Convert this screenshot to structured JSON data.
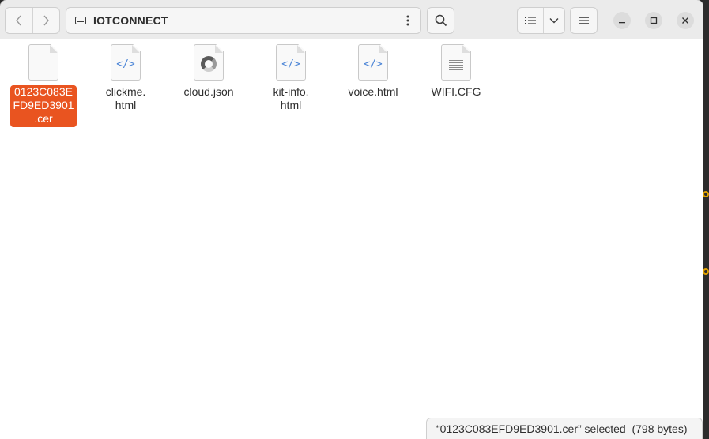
{
  "window": {
    "path_label": "IOTCONNECT",
    "icons": {
      "back": "chevron-left-icon",
      "forward": "chevron-right-icon",
      "drive": "drive-icon",
      "path_menu": "kebab-icon",
      "search": "search-icon",
      "view": "list-view-icon",
      "view_options": "chevron-down-icon",
      "menu": "hamburger-icon",
      "minimize": "minimize-icon",
      "maximize": "maximize-icon",
      "close": "close-icon"
    }
  },
  "files": [
    {
      "name": "0123C083E\nFD9ED3901\n.cer",
      "kind": "blank",
      "selected": true
    },
    {
      "name": "clickme.\nhtml",
      "kind": "code"
    },
    {
      "name": "cloud.json",
      "kind": "json"
    },
    {
      "name": "kit-info.\nhtml",
      "kind": "code"
    },
    {
      "name": "voice.html",
      "kind": "code"
    },
    {
      "name": "WIFI.CFG",
      "kind": "text"
    }
  ],
  "code_glyph": "</>",
  "status": "“0123C083EFD9ED3901.cer” selected  (798 bytes)",
  "colors": {
    "selection": "#e95420",
    "code_icon": "#4a84d6"
  }
}
